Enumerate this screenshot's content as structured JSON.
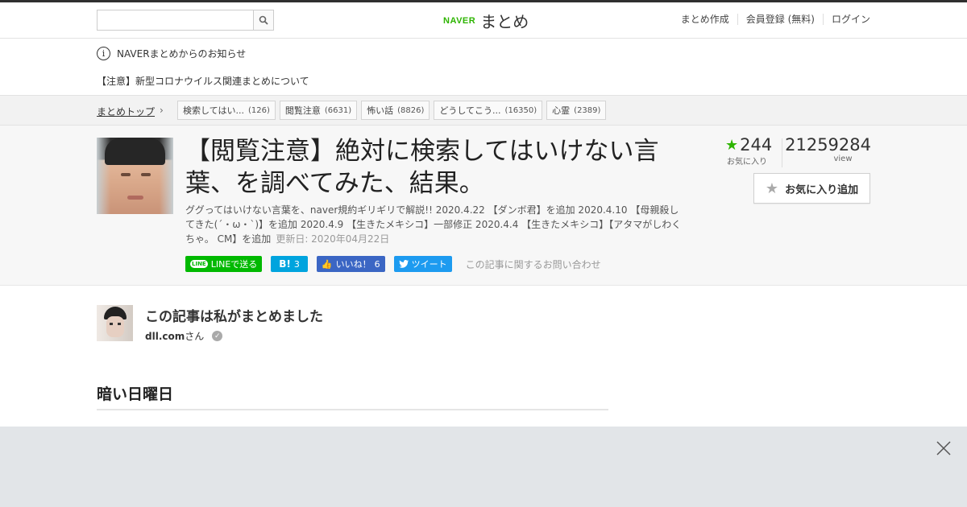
{
  "header": {
    "search_placeholder": "",
    "logo_brand": "NAVER",
    "logo_text": "まとめ",
    "nav": [
      "まとめ作成",
      "会員登録 (無料)",
      "ログイン"
    ]
  },
  "notice": {
    "title": "NAVERまとめからのお知らせ",
    "message": "【注意】新型コロナウイルス関連まとめについて"
  },
  "breadcrumb": {
    "top": "まとめトップ",
    "tags": [
      {
        "label": "検索してはい...",
        "count": "(126)"
      },
      {
        "label": "閲覧注意",
        "count": "(6631)"
      },
      {
        "label": "怖い話",
        "count": "(8826)"
      },
      {
        "label": "どうしてこう...",
        "count": "(16350)"
      },
      {
        "label": "心霊",
        "count": "(2389)"
      }
    ]
  },
  "article": {
    "title": "【閲覧注意】絶対に検索してはいけない言葉、を調べてみた、結果。",
    "description": "ググってはいけない言葉を、naver規約ギリギリで解説!! 2020.4.22 【ダンボ君】を追加 2020.4.10 【母親殺してきた(´・ω・`)】を追加 2020.4.9 【生きたメキシコ】一部修正 2020.4.4 【生きたメキシコ】【アタマがしわくちゃ。 CM】を追加",
    "updated": "更新日: 2020年04月22日",
    "favorites": "244",
    "favorites_label": "お気に入り",
    "views": "21259284",
    "views_label": "view",
    "fav_button": "お気に入り追加",
    "share": {
      "line": "LINEで送る",
      "line_icon": "LINE",
      "hatena_icon": "B!",
      "hatena_count": "3",
      "fb_label": "いいね！",
      "fb_count": "6",
      "tweet": "ツイート",
      "contact": "この記事に関するお問い合わせ"
    }
  },
  "author": {
    "heading": "この記事は私がまとめました",
    "name": "dll.com",
    "suffix": "さん"
  },
  "section": {
    "heading": "暗い日曜日"
  },
  "colors": {
    "brand_green": "#2db400",
    "line_green": "#00b900",
    "hatena_blue": "#00a4de",
    "facebook_blue": "#3b66c4",
    "twitter_blue": "#1d9bf0"
  }
}
